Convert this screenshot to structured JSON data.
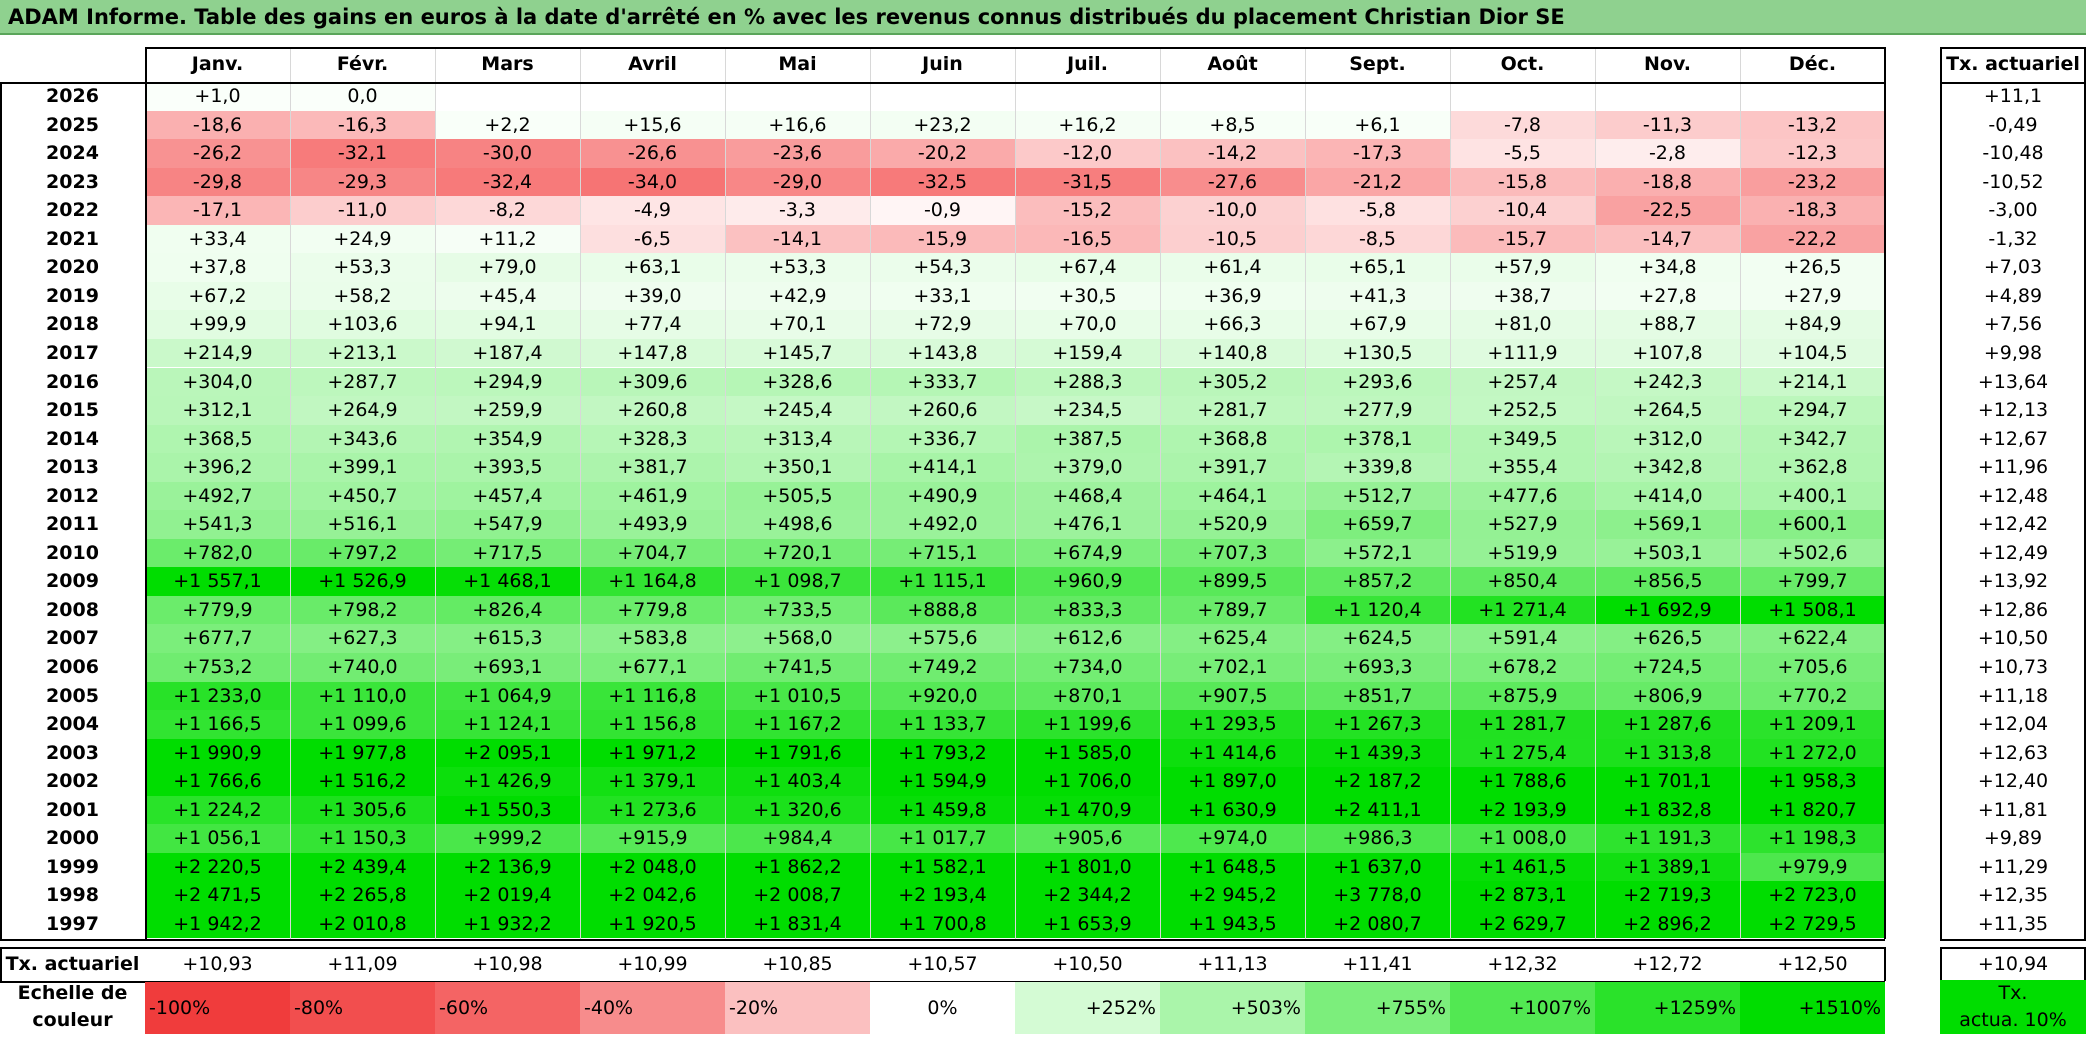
{
  "title": "ADAM Informe. Table des gains en euros à la date d'arrêté en % avec les revenus connus distribués du placement Christian Dior SE",
  "chart_data": {
    "type": "table",
    "columns": [
      "Janv.",
      "Févr.",
      "Mars",
      "Avril",
      "Mai",
      "Juin",
      "Juil.",
      "Août",
      "Sept.",
      "Oct.",
      "Nov.",
      "Déc."
    ],
    "last_column_header": "Tx. actuariel",
    "rows": [
      {
        "year": "2026",
        "values": [
          "+1,0",
          "0,0",
          "",
          "",
          "",
          "",
          "",
          "",
          "",
          "",
          "",
          ""
        ],
        "tx": "+11,1"
      },
      {
        "year": "2025",
        "values": [
          "-18,6",
          "-16,3",
          "+2,2",
          "+15,6",
          "+16,6",
          "+23,2",
          "+16,2",
          "+8,5",
          "+6,1",
          "-7,8",
          "-11,3",
          "-13,2"
        ],
        "tx": "-0,49"
      },
      {
        "year": "2024",
        "values": [
          "-26,2",
          "-32,1",
          "-30,0",
          "-26,6",
          "-23,6",
          "-20,2",
          "-12,0",
          "-14,2",
          "-17,3",
          "-5,5",
          "-2,8",
          "-12,3"
        ],
        "tx": "-10,48"
      },
      {
        "year": "2023",
        "values": [
          "-29,8",
          "-29,3",
          "-32,4",
          "-34,0",
          "-29,0",
          "-32,5",
          "-31,5",
          "-27,6",
          "-21,2",
          "-15,8",
          "-18,8",
          "-23,2"
        ],
        "tx": "-10,52"
      },
      {
        "year": "2022",
        "values": [
          "-17,1",
          "-11,0",
          "-8,2",
          "-4,9",
          "-3,3",
          "-0,9",
          "-15,2",
          "-10,0",
          "-5,8",
          "-10,4",
          "-22,5",
          "-18,3"
        ],
        "tx": "-3,00"
      },
      {
        "year": "2021",
        "values": [
          "+33,4",
          "+24,9",
          "+11,2",
          "-6,5",
          "-14,1",
          "-15,9",
          "-16,5",
          "-10,5",
          "-8,5",
          "-15,7",
          "-14,7",
          "-22,2"
        ],
        "tx": "-1,32"
      },
      {
        "year": "2020",
        "values": [
          "+37,8",
          "+53,3",
          "+79,0",
          "+63,1",
          "+53,3",
          "+54,3",
          "+67,4",
          "+61,4",
          "+65,1",
          "+57,9",
          "+34,8",
          "+26,5"
        ],
        "tx": "+7,03"
      },
      {
        "year": "2019",
        "values": [
          "+67,2",
          "+58,2",
          "+45,4",
          "+39,0",
          "+42,9",
          "+33,1",
          "+30,5",
          "+36,9",
          "+41,3",
          "+38,7",
          "+27,8",
          "+27,9"
        ],
        "tx": "+4,89"
      },
      {
        "year": "2018",
        "values": [
          "+99,9",
          "+103,6",
          "+94,1",
          "+77,4",
          "+70,1",
          "+72,9",
          "+70,0",
          "+66,3",
          "+67,9",
          "+81,0",
          "+88,7",
          "+84,9"
        ],
        "tx": "+7,56"
      },
      {
        "year": "2017",
        "values": [
          "+214,9",
          "+213,1",
          "+187,4",
          "+147,8",
          "+145,7",
          "+143,8",
          "+159,4",
          "+140,8",
          "+130,5",
          "+111,9",
          "+107,8",
          "+104,5"
        ],
        "tx": "+9,98"
      },
      {
        "year": "2016",
        "values": [
          "+304,0",
          "+287,7",
          "+294,9",
          "+309,6",
          "+328,6",
          "+333,7",
          "+288,3",
          "+305,2",
          "+293,6",
          "+257,4",
          "+242,3",
          "+214,1"
        ],
        "tx": "+13,64"
      },
      {
        "year": "2015",
        "values": [
          "+312,1",
          "+264,9",
          "+259,9",
          "+260,8",
          "+245,4",
          "+260,6",
          "+234,5",
          "+281,7",
          "+277,9",
          "+252,5",
          "+264,5",
          "+294,7"
        ],
        "tx": "+12,13"
      },
      {
        "year": "2014",
        "values": [
          "+368,5",
          "+343,6",
          "+354,9",
          "+328,3",
          "+313,4",
          "+336,7",
          "+387,5",
          "+368,8",
          "+378,1",
          "+349,5",
          "+312,0",
          "+342,7"
        ],
        "tx": "+12,67"
      },
      {
        "year": "2013",
        "values": [
          "+396,2",
          "+399,1",
          "+393,5",
          "+381,7",
          "+350,1",
          "+414,1",
          "+379,0",
          "+391,7",
          "+339,8",
          "+355,4",
          "+342,8",
          "+362,8"
        ],
        "tx": "+11,96"
      },
      {
        "year": "2012",
        "values": [
          "+492,7",
          "+450,7",
          "+457,4",
          "+461,9",
          "+505,5",
          "+490,9",
          "+468,4",
          "+464,1",
          "+512,7",
          "+477,6",
          "+414,0",
          "+400,1"
        ],
        "tx": "+12,48"
      },
      {
        "year": "2011",
        "values": [
          "+541,3",
          "+516,1",
          "+547,9",
          "+493,9",
          "+498,6",
          "+492,0",
          "+476,1",
          "+520,9",
          "+659,7",
          "+527,9",
          "+569,1",
          "+600,1"
        ],
        "tx": "+12,42"
      },
      {
        "year": "2010",
        "values": [
          "+782,0",
          "+797,2",
          "+717,5",
          "+704,7",
          "+720,1",
          "+715,1",
          "+674,9",
          "+707,3",
          "+572,1",
          "+519,9",
          "+503,1",
          "+502,6"
        ],
        "tx": "+12,49"
      },
      {
        "year": "2009",
        "values": [
          "+1 557,1",
          "+1 526,9",
          "+1 468,1",
          "+1 164,8",
          "+1 098,7",
          "+1 115,1",
          "+960,9",
          "+899,5",
          "+857,2",
          "+850,4",
          "+856,5",
          "+799,7"
        ],
        "tx": "+13,92"
      },
      {
        "year": "2008",
        "values": [
          "+779,9",
          "+798,2",
          "+826,4",
          "+779,8",
          "+733,5",
          "+888,8",
          "+833,3",
          "+789,7",
          "+1 120,4",
          "+1 271,4",
          "+1 692,9",
          "+1 508,1"
        ],
        "tx": "+12,86"
      },
      {
        "year": "2007",
        "values": [
          "+677,7",
          "+627,3",
          "+615,3",
          "+583,8",
          "+568,0",
          "+575,6",
          "+612,6",
          "+625,4",
          "+624,5",
          "+591,4",
          "+626,5",
          "+622,4"
        ],
        "tx": "+10,50"
      },
      {
        "year": "2006",
        "values": [
          "+753,2",
          "+740,0",
          "+693,1",
          "+677,1",
          "+741,5",
          "+749,2",
          "+734,0",
          "+702,1",
          "+693,3",
          "+678,2",
          "+724,5",
          "+705,6"
        ],
        "tx": "+10,73"
      },
      {
        "year": "2005",
        "values": [
          "+1 233,0",
          "+1 110,0",
          "+1 064,9",
          "+1 116,8",
          "+1 010,5",
          "+920,0",
          "+870,1",
          "+907,5",
          "+851,7",
          "+875,9",
          "+806,9",
          "+770,2"
        ],
        "tx": "+11,18"
      },
      {
        "year": "2004",
        "values": [
          "+1 166,5",
          "+1 099,6",
          "+1 124,1",
          "+1 156,8",
          "+1 167,2",
          "+1 133,7",
          "+1 199,6",
          "+1 293,5",
          "+1 267,3",
          "+1 281,7",
          "+1 287,6",
          "+1 209,1"
        ],
        "tx": "+12,04"
      },
      {
        "year": "2003",
        "values": [
          "+1 990,9",
          "+1 977,8",
          "+2 095,1",
          "+1 971,2",
          "+1 791,6",
          "+1 793,2",
          "+1 585,0",
          "+1 414,6",
          "+1 439,3",
          "+1 275,4",
          "+1 313,8",
          "+1 272,0"
        ],
        "tx": "+12,63"
      },
      {
        "year": "2002",
        "values": [
          "+1 766,6",
          "+1 516,2",
          "+1 426,9",
          "+1 379,1",
          "+1 403,4",
          "+1 594,9",
          "+1 706,0",
          "+1 897,0",
          "+2 187,2",
          "+1 788,6",
          "+1 701,1",
          "+1 958,3"
        ],
        "tx": "+12,40"
      },
      {
        "year": "2001",
        "values": [
          "+1 224,2",
          "+1 305,6",
          "+1 550,3",
          "+1 273,6",
          "+1 320,6",
          "+1 459,8",
          "+1 470,9",
          "+1 630,9",
          "+2 411,1",
          "+2 193,9",
          "+1 832,8",
          "+1 820,7"
        ],
        "tx": "+11,81"
      },
      {
        "year": "2000",
        "values": [
          "+1 056,1",
          "+1 150,3",
          "+999,2",
          "+915,9",
          "+984,4",
          "+1 017,7",
          "+905,6",
          "+974,0",
          "+986,3",
          "+1 008,0",
          "+1 191,3",
          "+1 198,3"
        ],
        "tx": "+9,89"
      },
      {
        "year": "1999",
        "values": [
          "+2 220,5",
          "+2 439,4",
          "+2 136,9",
          "+2 048,0",
          "+1 862,2",
          "+1 582,1",
          "+1 801,0",
          "+1 648,5",
          "+1 637,0",
          "+1 461,5",
          "+1 389,1",
          "+979,9"
        ],
        "tx": "+11,29"
      },
      {
        "year": "1998",
        "values": [
          "+2 471,5",
          "+2 265,8",
          "+2 019,4",
          "+2 042,6",
          "+2 008,7",
          "+2 193,4",
          "+2 344,2",
          "+2 945,2",
          "+3 778,0",
          "+2 873,1",
          "+2 719,3",
          "+2 723,0"
        ],
        "tx": "+12,35"
      },
      {
        "year": "1997",
        "values": [
          "+1 942,2",
          "+2 010,8",
          "+1 932,2",
          "+1 920,5",
          "+1 831,4",
          "+1 700,8",
          "+1 653,9",
          "+1 943,5",
          "+2 080,7",
          "+2 629,7",
          "+2 896,2",
          "+2 729,5"
        ],
        "tx": "+11,35"
      }
    ],
    "footer_row": {
      "label": "Tx. actuariel",
      "values": [
        "+10,93",
        "+11,09",
        "+10,98",
        "+10,99",
        "+10,85",
        "+10,57",
        "+10,50",
        "+11,13",
        "+11,41",
        "+12,32",
        "+12,72",
        "+12,50"
      ],
      "tx": "+10,94"
    },
    "color_scale": {
      "label_line1": "Echelle de",
      "label_line2": "couleur",
      "stops": [
        {
          "label": "-100%",
          "color": "#f03c3c",
          "align": "left"
        },
        {
          "label": "-80%",
          "color": "#f24e4e",
          "align": "left"
        },
        {
          "label": "-60%",
          "color": "#f46464",
          "align": "left"
        },
        {
          "label": "-40%",
          "color": "#f78c8c",
          "align": "left"
        },
        {
          "label": "-20%",
          "color": "#fbc0c0",
          "align": "left"
        },
        {
          "label": "0%",
          "color": "#ffffff",
          "align": "center"
        },
        {
          "label": "+252%",
          "color": "#d4fbd4",
          "align": "right"
        },
        {
          "label": "+503%",
          "color": "#aaf5aa",
          "align": "right"
        },
        {
          "label": "+755%",
          "color": "#7cee7c",
          "align": "right"
        },
        {
          "label": "+1007%",
          "color": "#52e852",
          "align": "right"
        },
        {
          "label": "+1259%",
          "color": "#2ae22a",
          "align": "right"
        },
        {
          "label": "+1510%",
          "color": "#00dd00",
          "align": "right"
        }
      ],
      "tx_label_line1": "Tx.",
      "tx_label_line2": "actua. 10%",
      "tx_color": "#00dd00"
    }
  }
}
